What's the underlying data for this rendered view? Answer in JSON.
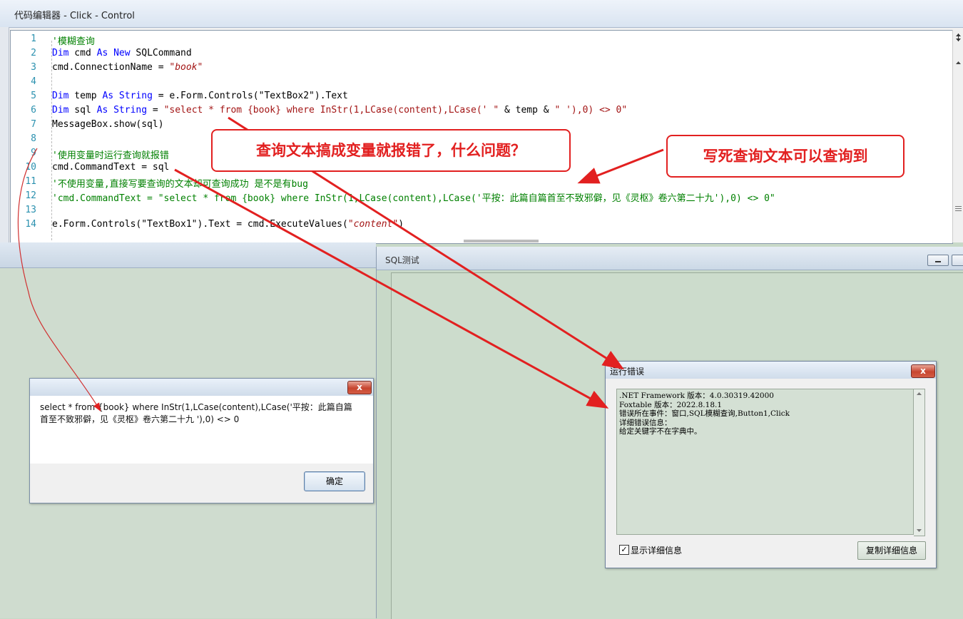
{
  "editor": {
    "title": "代码编辑器 - Click - Control",
    "line_numbers": [
      "1",
      "2",
      "3",
      "4",
      "5",
      "6",
      "7",
      "8",
      "9",
      "10",
      "11",
      "12",
      "13",
      "14"
    ],
    "lines": [
      [
        {
          "t": "'模糊查询",
          "c": "cm"
        }
      ],
      [
        {
          "t": "Dim",
          "c": "kw"
        },
        {
          "t": " cmd ",
          "c": ""
        },
        {
          "t": "As New",
          "c": "kw"
        },
        {
          "t": " SQLCommand",
          "c": ""
        }
      ],
      [
        {
          "t": "cmd.ConnectionName = ",
          "c": ""
        },
        {
          "t": "\"book\"",
          "c": "str"
        }
      ],
      [],
      [
        {
          "t": "Dim",
          "c": "kw"
        },
        {
          "t": " temp ",
          "c": ""
        },
        {
          "t": "As String",
          "c": "kw"
        },
        {
          "t": " = e.Form.Controls(\"TextBox2\").Text",
          "c": ""
        }
      ],
      [
        {
          "t": "Dim",
          "c": "kw"
        },
        {
          "t": " sql ",
          "c": ""
        },
        {
          "t": "As String",
          "c": "kw"
        },
        {
          "t": " = ",
          "c": ""
        },
        {
          "t": "\"select * from {book} where InStr(1,LCase(content),LCase(' \"",
          "c": "str2"
        },
        {
          "t": " & temp & ",
          "c": ""
        },
        {
          "t": "\" '),0) <> 0\"",
          "c": "str2"
        }
      ],
      [
        {
          "t": "MessageBox.show(sql)",
          "c": ""
        }
      ],
      [],
      [
        {
          "t": "'使用变量时运行查询就报错",
          "c": "cm"
        }
      ],
      [
        {
          "t": "cmd.CommandText = sql",
          "c": ""
        }
      ],
      [
        {
          "t": "'不使用变量,直接写要查询的文本却可查询成功 是不是有bug",
          "c": "cm"
        }
      ],
      [
        {
          "t": "'cmd.CommandText = \"select * from {book} where InStr(1,LCase(content),LCase('平按：此篇自篇首至不致邪僻，见《灵枢》卷六第二十九'),0) <> 0\"",
          "c": "cm"
        }
      ],
      [],
      [
        {
          "t": "e.Form.Controls(\"TextBox1\").Text = cmd.ExecuteValues(",
          "c": ""
        },
        {
          "t": "\"content\"",
          "c": "str"
        },
        {
          "t": ")",
          "c": ""
        }
      ]
    ]
  },
  "sql_window": {
    "title": "SQL测试"
  },
  "msgbox": {
    "text": "select * from {book} where InStr(1,LCase(content),LCase('平按：此篇自篇首至不致邪僻，见《灵枢》卷六第二十九 '),0) <> 0",
    "ok_label": "确定",
    "close_glyph": "x"
  },
  "error_dialog": {
    "title": "运行错误",
    "close_glyph": "x",
    "lines": [
      ".NET Framework 版本：4.0.30319.42000",
      "Foxtable 版本：2022.8.18.1",
      "错误所在事件：窗口,SQL模糊查询,Button1,Click",
      "详细错误信息：",
      "给定关键字不在字典中。"
    ],
    "show_details_label": "显示详细信息",
    "show_details_checked": true,
    "copy_label": "复制详细信息"
  },
  "annotations": {
    "callout1": "查询文本搞成变量就报错了，什么问题？",
    "callout2": "写死查询文本可以查询到"
  },
  "colors": {
    "annotation": "#e22020"
  }
}
